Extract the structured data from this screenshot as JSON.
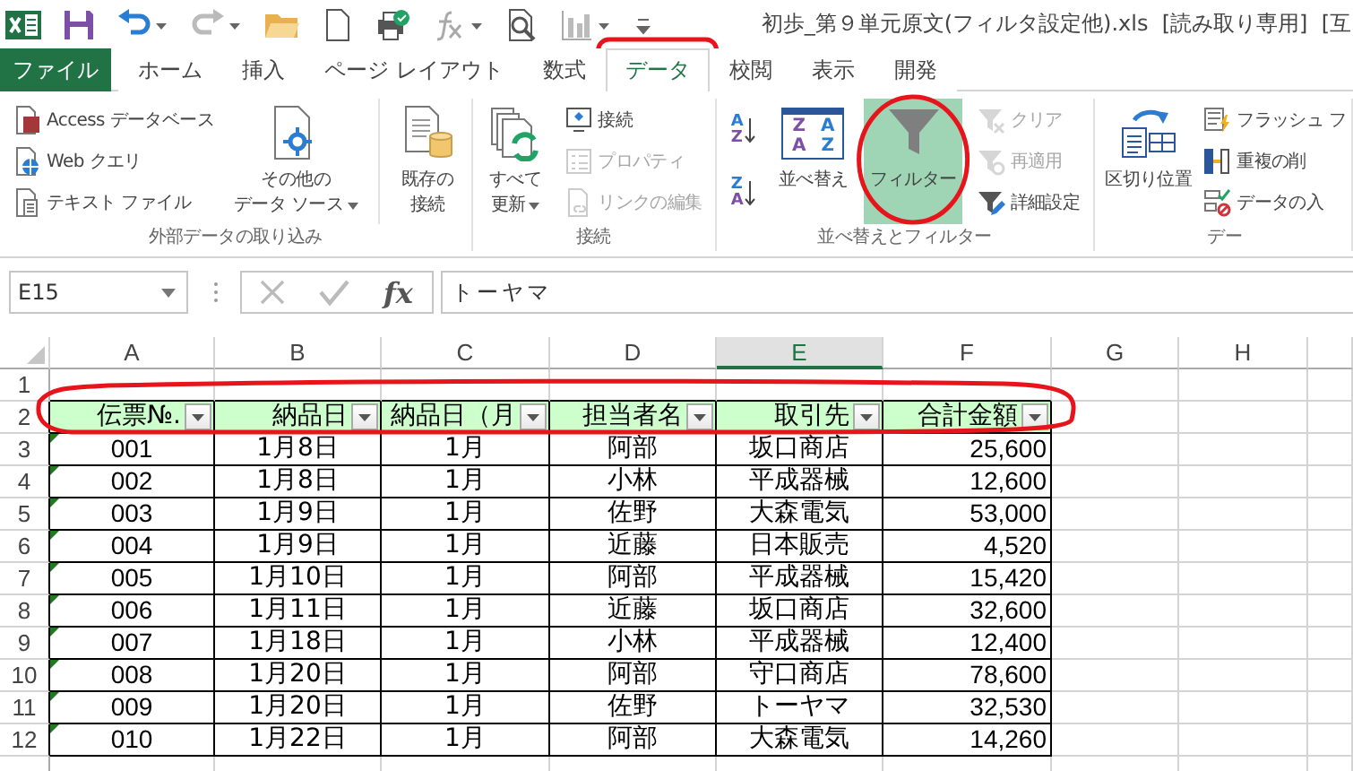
{
  "title_bar": {
    "title": "初歩_第９単元原文(フィルタ設定他).xls  [読み取り専用]  [互"
  },
  "tabs": [
    {
      "label": "ファイル",
      "kind": "file",
      "selected": false
    },
    {
      "label": "ホーム",
      "kind": "tab",
      "selected": false
    },
    {
      "label": "挿入",
      "kind": "tab",
      "selected": false
    },
    {
      "label": "ページ レイアウト",
      "kind": "tab",
      "selected": false
    },
    {
      "label": "数式",
      "kind": "tab",
      "selected": false
    },
    {
      "label": "データ",
      "kind": "tab",
      "selected": true
    },
    {
      "label": "校閲",
      "kind": "tab",
      "selected": false
    },
    {
      "label": "表示",
      "kind": "tab",
      "selected": false
    },
    {
      "label": "開発",
      "kind": "tab",
      "selected": false
    }
  ],
  "ribbon": {
    "groups": [
      {
        "label": "外部データの取り込み",
        "items": [
          {
            "kind": "stack",
            "buttons": [
              {
                "label": "Access データベース",
                "disabled": false
              },
              {
                "label": "Web クエリ",
                "disabled": false
              },
              {
                "label": "テキスト ファイル",
                "disabled": false
              }
            ]
          },
          {
            "kind": "large",
            "lines": [
              "その他の",
              "データ ソース"
            ],
            "dropdown": true,
            "selected": false
          },
          {
            "kind": "separator"
          },
          {
            "kind": "large",
            "lines": [
              "既存の",
              "接続"
            ],
            "dropdown": false,
            "selected": false
          }
        ]
      },
      {
        "label": "接続",
        "items": [
          {
            "kind": "large",
            "lines": [
              "すべて",
              "更新"
            ],
            "dropdown": true,
            "selected": false
          },
          {
            "kind": "stack",
            "buttons": [
              {
                "label": "接続",
                "disabled": false
              },
              {
                "label": "プロパティ",
                "disabled": true
              },
              {
                "label": "リンクの編集",
                "disabled": true
              }
            ]
          }
        ]
      },
      {
        "label": "並べ替えとフィルター",
        "items": [
          {
            "kind": "sort_pair",
            "buttons": [
              {
                "letters": [
                  "A",
                  "Z"
                ]
              },
              {
                "letters": [
                  "Z",
                  "A"
                ]
              }
            ]
          },
          {
            "kind": "large",
            "lines": [
              "並べ替え"
            ],
            "icon_letters": [
              "Z",
              "A",
              "A",
              "Z"
            ],
            "dropdown": false,
            "selected": false
          },
          {
            "kind": "large",
            "lines": [
              "フィルター"
            ],
            "dropdown": false,
            "selected": true
          },
          {
            "kind": "stack",
            "buttons": [
              {
                "label": "クリア",
                "disabled": true
              },
              {
                "label": "再適用",
                "disabled": true
              },
              {
                "label": "詳細設定",
                "disabled": false
              }
            ]
          }
        ]
      },
      {
        "label": "デー",
        "items": [
          {
            "kind": "large",
            "lines": [
              "区切り位置"
            ],
            "dropdown": false,
            "selected": false
          },
          {
            "kind": "stack",
            "buttons": [
              {
                "label": "フラッシュ フ",
                "disabled": false
              },
              {
                "label": "重複の削",
                "disabled": false
              },
              {
                "label": "データの入",
                "disabled": false
              }
            ]
          }
        ]
      }
    ]
  },
  "formula_bar": {
    "name_box": "E15",
    "function_label": "fx",
    "value": "トーヤマ"
  },
  "sheet": {
    "columns": [
      {
        "label": "A",
        "selected": false
      },
      {
        "label": "B",
        "selected": false
      },
      {
        "label": "C",
        "selected": false
      },
      {
        "label": "D",
        "selected": false
      },
      {
        "label": "E",
        "selected": true
      },
      {
        "label": "F",
        "selected": false
      },
      {
        "label": "G",
        "selected": false
      },
      {
        "label": "H",
        "selected": false
      }
    ],
    "rows": [
      {
        "number": "1",
        "kind": "blank"
      },
      {
        "number": "2",
        "kind": "header",
        "cells": [
          "伝票№.",
          "納品日",
          "納品日（月",
          "担当者名",
          "取引先",
          "合計金額"
        ]
      },
      {
        "number": "3",
        "kind": "data",
        "flagged": true,
        "cells": [
          "001",
          "1月8日",
          "1月",
          "阿部",
          "坂口商店",
          "25,600"
        ]
      },
      {
        "number": "4",
        "kind": "data",
        "flagged": true,
        "cells": [
          "002",
          "1月8日",
          "1月",
          "小林",
          "平成器械",
          "12,600"
        ]
      },
      {
        "number": "5",
        "kind": "data",
        "flagged": true,
        "cells": [
          "003",
          "1月9日",
          "1月",
          "佐野",
          "大森電気",
          "53,000"
        ]
      },
      {
        "number": "6",
        "kind": "data",
        "flagged": true,
        "cells": [
          "004",
          "1月9日",
          "1月",
          "近藤",
          "日本販売",
          "4,520"
        ]
      },
      {
        "number": "7",
        "kind": "data",
        "flagged": true,
        "cells": [
          "005",
          "1月10日",
          "1月",
          "阿部",
          "平成器械",
          "15,420"
        ]
      },
      {
        "number": "8",
        "kind": "data",
        "flagged": true,
        "cells": [
          "006",
          "1月11日",
          "1月",
          "近藤",
          "坂口商店",
          "32,600"
        ]
      },
      {
        "number": "9",
        "kind": "data",
        "flagged": true,
        "cells": [
          "007",
          "1月18日",
          "1月",
          "小林",
          "平成器械",
          "12,400"
        ]
      },
      {
        "number": "10",
        "kind": "data",
        "flagged": true,
        "cells": [
          "008",
          "1月20日",
          "1月",
          "阿部",
          "守口商店",
          "78,600"
        ]
      },
      {
        "number": "11",
        "kind": "data",
        "flagged": true,
        "cells": [
          "009",
          "1月20日",
          "1月",
          "佐野",
          "トーヤマ",
          "32,530"
        ]
      },
      {
        "number": "12",
        "kind": "data",
        "flagged": true,
        "cells": [
          "010",
          "1月22日",
          "1月",
          "阿部",
          "大森電気",
          "14,260"
        ]
      }
    ]
  }
}
